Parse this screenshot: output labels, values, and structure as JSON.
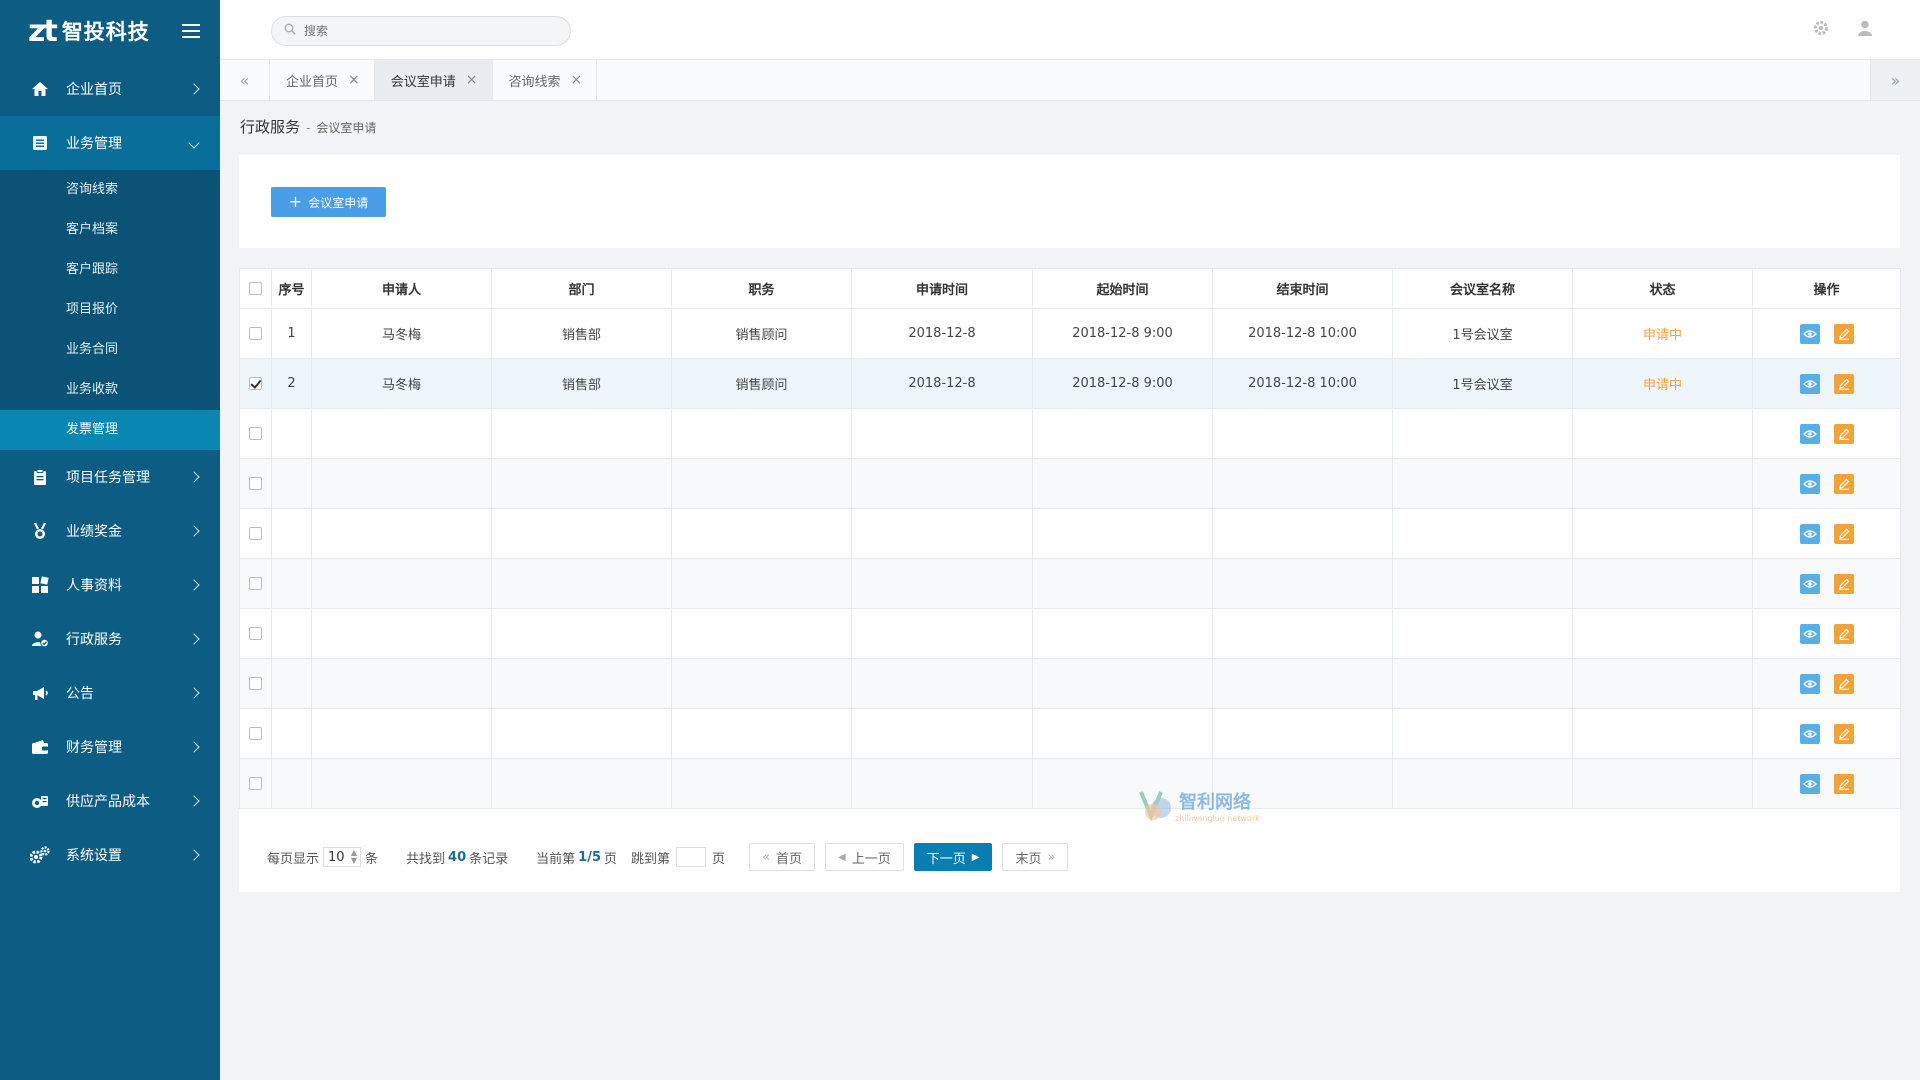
{
  "brand": {
    "mark": "zt",
    "name": "智投科技"
  },
  "search": {
    "placeholder": "搜索"
  },
  "sidebar": {
    "items": [
      {
        "label": "企业首页",
        "icon": "home-icon"
      },
      {
        "label": "业务管理",
        "icon": "list-icon",
        "open": true
      },
      {
        "label": "项目任务管理",
        "icon": "clipboard-icon"
      },
      {
        "label": "业绩奖金",
        "icon": "medal-icon"
      },
      {
        "label": "人事资料",
        "icon": "grid-icon"
      },
      {
        "label": "行政服务",
        "icon": "user-check-icon"
      },
      {
        "label": "公告",
        "icon": "megaphone-icon"
      },
      {
        "label": "财务管理",
        "icon": "wallet-icon"
      },
      {
        "label": "供应产品成本",
        "icon": "coins-icon"
      },
      {
        "label": "系统设置",
        "icon": "gears-icon"
      }
    ],
    "submenu": [
      {
        "label": "咨询线索"
      },
      {
        "label": "客户档案"
      },
      {
        "label": "客户跟踪"
      },
      {
        "label": "项目报价"
      },
      {
        "label": "业务合同"
      },
      {
        "label": "业务收款"
      },
      {
        "label": "发票管理",
        "active": true
      }
    ]
  },
  "tabs": [
    {
      "label": "企业首页"
    },
    {
      "label": "会议室申请",
      "active": true
    },
    {
      "label": "咨询线索"
    }
  ],
  "breadcrumb": {
    "main": "行政服务",
    "sep": "-",
    "sub": "会议室申请"
  },
  "toolbar": {
    "add_label": "会议室申请"
  },
  "table": {
    "headers": [
      "序号",
      "申请人",
      "部门",
      "职务",
      "申请时间",
      "起始时间",
      "结束时间",
      "会议室名称",
      "状态",
      "操作"
    ],
    "rows": [
      {
        "no": "1",
        "applicant": "马冬梅",
        "dept": "销售部",
        "position": "销售顾问",
        "apply_time": "2018-12-8",
        "start_time": "2018-12-8  9:00",
        "end_time": "2018-12-8  10:00",
        "room": "1号会议室",
        "status": "申请中",
        "checked": false
      },
      {
        "no": "2",
        "applicant": "马冬梅",
        "dept": "销售部",
        "position": "销售顾问",
        "apply_time": "2018-12-8",
        "start_time": "2018-12-8  9:00",
        "end_time": "2018-12-8  10:00",
        "room": "1号会议室",
        "status": "申请中",
        "checked": true
      },
      {
        "no": "",
        "applicant": "",
        "dept": "",
        "position": "",
        "apply_time": "",
        "start_time": "",
        "end_time": "",
        "room": "",
        "status": "",
        "checked": false
      },
      {
        "no": "",
        "applicant": "",
        "dept": "",
        "position": "",
        "apply_time": "",
        "start_time": "",
        "end_time": "",
        "room": "",
        "status": "",
        "checked": false
      },
      {
        "no": "",
        "applicant": "",
        "dept": "",
        "position": "",
        "apply_time": "",
        "start_time": "",
        "end_time": "",
        "room": "",
        "status": "",
        "checked": false
      },
      {
        "no": "",
        "applicant": "",
        "dept": "",
        "position": "",
        "apply_time": "",
        "start_time": "",
        "end_time": "",
        "room": "",
        "status": "",
        "checked": false
      },
      {
        "no": "",
        "applicant": "",
        "dept": "",
        "position": "",
        "apply_time": "",
        "start_time": "",
        "end_time": "",
        "room": "",
        "status": "",
        "checked": false
      },
      {
        "no": "",
        "applicant": "",
        "dept": "",
        "position": "",
        "apply_time": "",
        "start_time": "",
        "end_time": "",
        "room": "",
        "status": "",
        "checked": false
      },
      {
        "no": "",
        "applicant": "",
        "dept": "",
        "position": "",
        "apply_time": "",
        "start_time": "",
        "end_time": "",
        "room": "",
        "status": "",
        "checked": false
      },
      {
        "no": "",
        "applicant": "",
        "dept": "",
        "position": "",
        "apply_time": "",
        "start_time": "",
        "end_time": "",
        "room": "",
        "status": "",
        "checked": false
      }
    ]
  },
  "pager": {
    "per_page_prefix": "每页显示",
    "per_page_value": "10",
    "per_page_suffix": "条",
    "total_prefix": "共找到",
    "total_value": "40",
    "total_suffix": "条记录",
    "current_prefix": "当前第",
    "current_value": "1/5",
    "current_suffix": "页",
    "jump_prefix": "跳到第",
    "jump_suffix": "页",
    "first": "首页",
    "prev": "上一页",
    "next": "下一页",
    "last": "末页"
  },
  "watermark": {
    "text": "智利网络",
    "sub": "zhiliwangluo network"
  },
  "colors": {
    "sidebar": "#0c5c84",
    "sidebar_active": "#0a86b2",
    "primary": "#4a9ee8",
    "status_pending": "#f0a33a",
    "edit": "#f0a33a",
    "view": "#5aaee6",
    "next_btn": "#0a7db3"
  }
}
